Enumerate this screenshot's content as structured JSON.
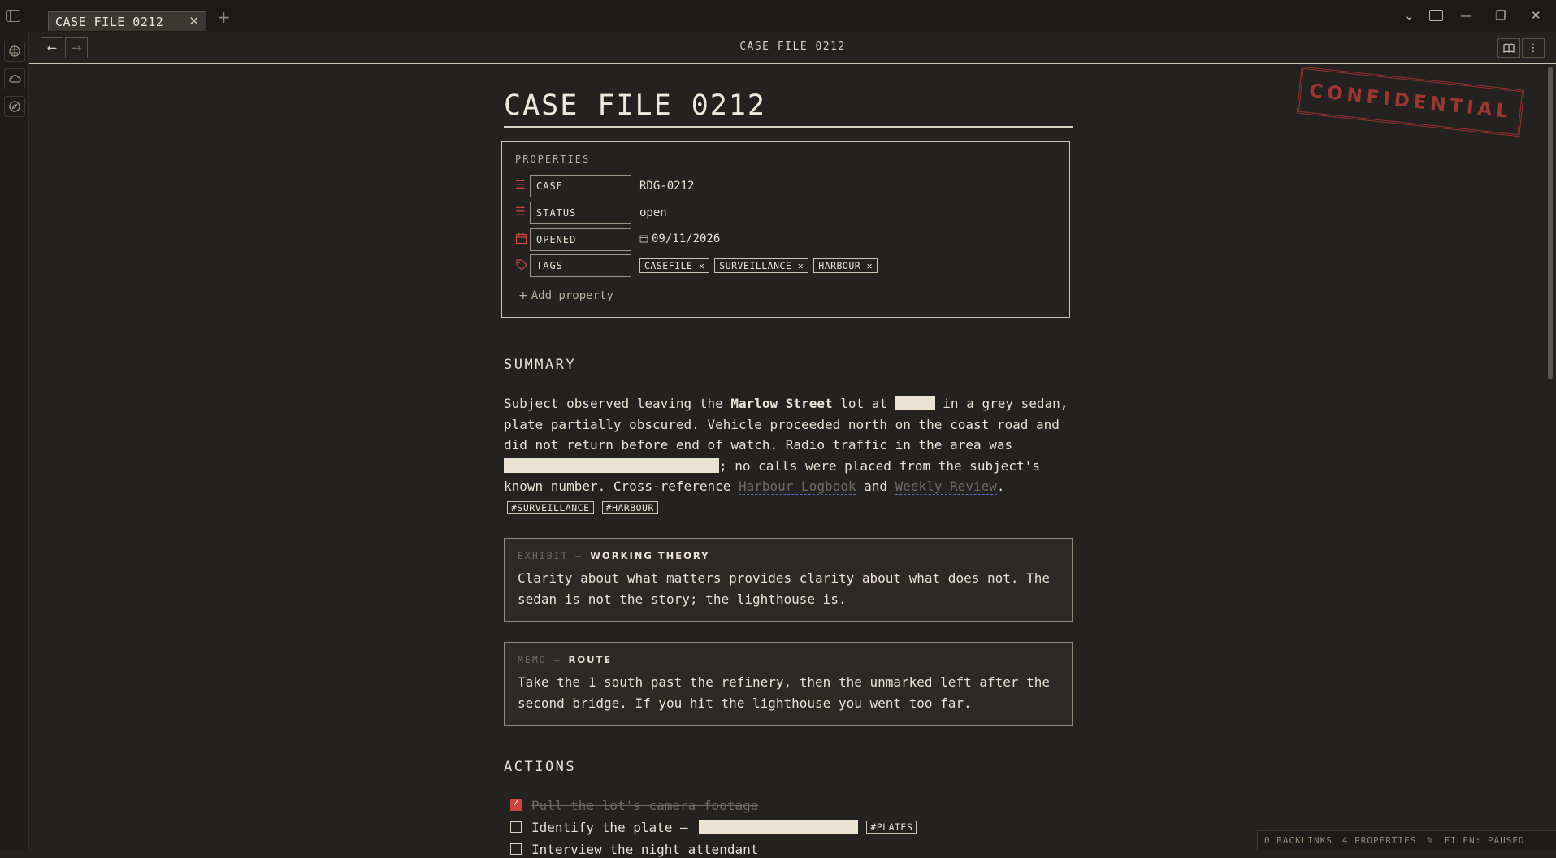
{
  "window": {
    "tab_title": "CASE FILE 0212",
    "tab_close": "✕",
    "new_tab": "+",
    "controls": [
      "⌄",
      "—",
      "❐",
      "✕"
    ]
  },
  "navbar": {
    "back": "←",
    "forward": "→",
    "title": "CASE FILE 0212"
  },
  "stamp": "CONFIDENTIAL",
  "document": {
    "title": "CASE FILE 0212",
    "properties": {
      "heading": "PROPERTIES",
      "rows": [
        {
          "key": "CASE",
          "value": "RDG-0212",
          "icon": "text-lines-icon"
        },
        {
          "key": "STATUS",
          "value": "open",
          "icon": "text-lines-icon"
        },
        {
          "key": "OPENED",
          "value": "09/11/2026",
          "icon": "calendar-icon"
        },
        {
          "key": "TAGS",
          "icon": "tag-icon"
        }
      ],
      "tags": [
        "CASEFILE",
        "SURVEILLANCE",
        "HARBOUR"
      ],
      "add_label": "Add property"
    },
    "summary": {
      "heading": "SUMMARY",
      "t1": "Subject observed leaving the ",
      "bold": "Marlow Street",
      "t2": " lot at ",
      "t3": " in a grey sedan, plate partially obscured. Vehicle proceeded north on the coast road and did not return before end of watch. Radio traffic in the area was ",
      "t4": "; no calls were placed from the subject's known number. Cross-reference ",
      "link1": "Harbour Logbook",
      "t5": " and ",
      "link2": "Weekly Review",
      "t6": ".",
      "tags": [
        "#SURVEILLANCE",
        "#HARBOUR"
      ]
    },
    "exhibit": {
      "label": "EXHIBIT — ",
      "title": "WORKING THEORY",
      "body": "Clarity about what matters provides clarity about what does not. The sedan is not the story; the lighthouse is."
    },
    "memo": {
      "label": "MEMO — ",
      "title": "ROUTE",
      "body": "Take the 1 south past the refinery, then the unmarked left after the second bridge. If you hit the lighthouse you went too far."
    },
    "actions": {
      "heading": "ACTIONS",
      "tasks": [
        {
          "text": "Pull the lot's camera footage",
          "done": true
        },
        {
          "text": "Identify the plate — ",
          "done": false,
          "tag": "#PLATES"
        },
        {
          "text": "Interview the night attendant",
          "done": false
        }
      ]
    }
  },
  "statusbar": {
    "backlinks": "0 BACKLINKS",
    "properties": "4 PROPERTIES",
    "filen": "FILEN: PAUSED"
  },
  "colors": {
    "background": "#242220",
    "accent_red": "#c9473f",
    "text": "#e8e2d6"
  }
}
